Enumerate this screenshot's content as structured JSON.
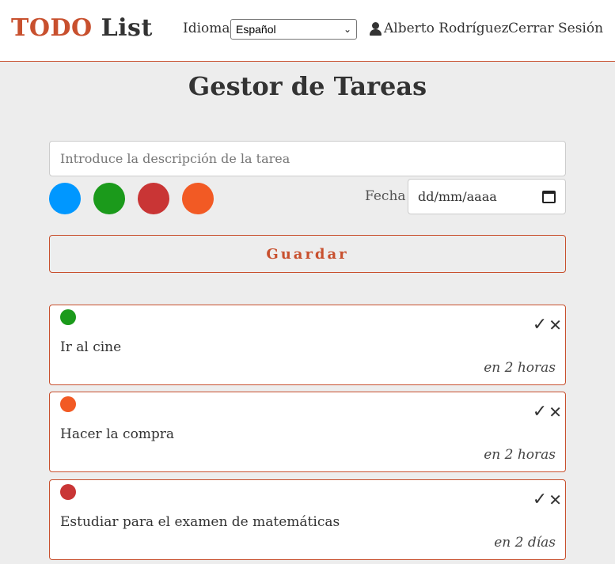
{
  "header": {
    "logo_part1": "TODO",
    "logo_part2": "List",
    "language_label": "Idioma",
    "language_selected": "Español",
    "user_name": "Alberto Rodríguez",
    "logout_label": "Cerrar Sesión"
  },
  "main": {
    "title": "Gestor de Tareas",
    "task_input_placeholder": "Introduce la descripción de la tarea",
    "colors": [
      "#0097ff",
      "#1b9a1b",
      "#c93535",
      "#f25a24"
    ],
    "date_label": "Fecha",
    "date_placeholder": "dd/mm/aaaa",
    "save_label": "Guardar"
  },
  "tasks": [
    {
      "color": "#1b9a1b",
      "description": "Ir al cine",
      "due": "en 2 horas"
    },
    {
      "color": "#f25a24",
      "description": "Hacer la compra",
      "due": "en 2 horas"
    },
    {
      "color": "#c93535",
      "description": "Estudiar para el examen de matemáticas",
      "due": "en 2 días"
    }
  ],
  "icons": {
    "complete": "✓",
    "delete": "✕"
  }
}
